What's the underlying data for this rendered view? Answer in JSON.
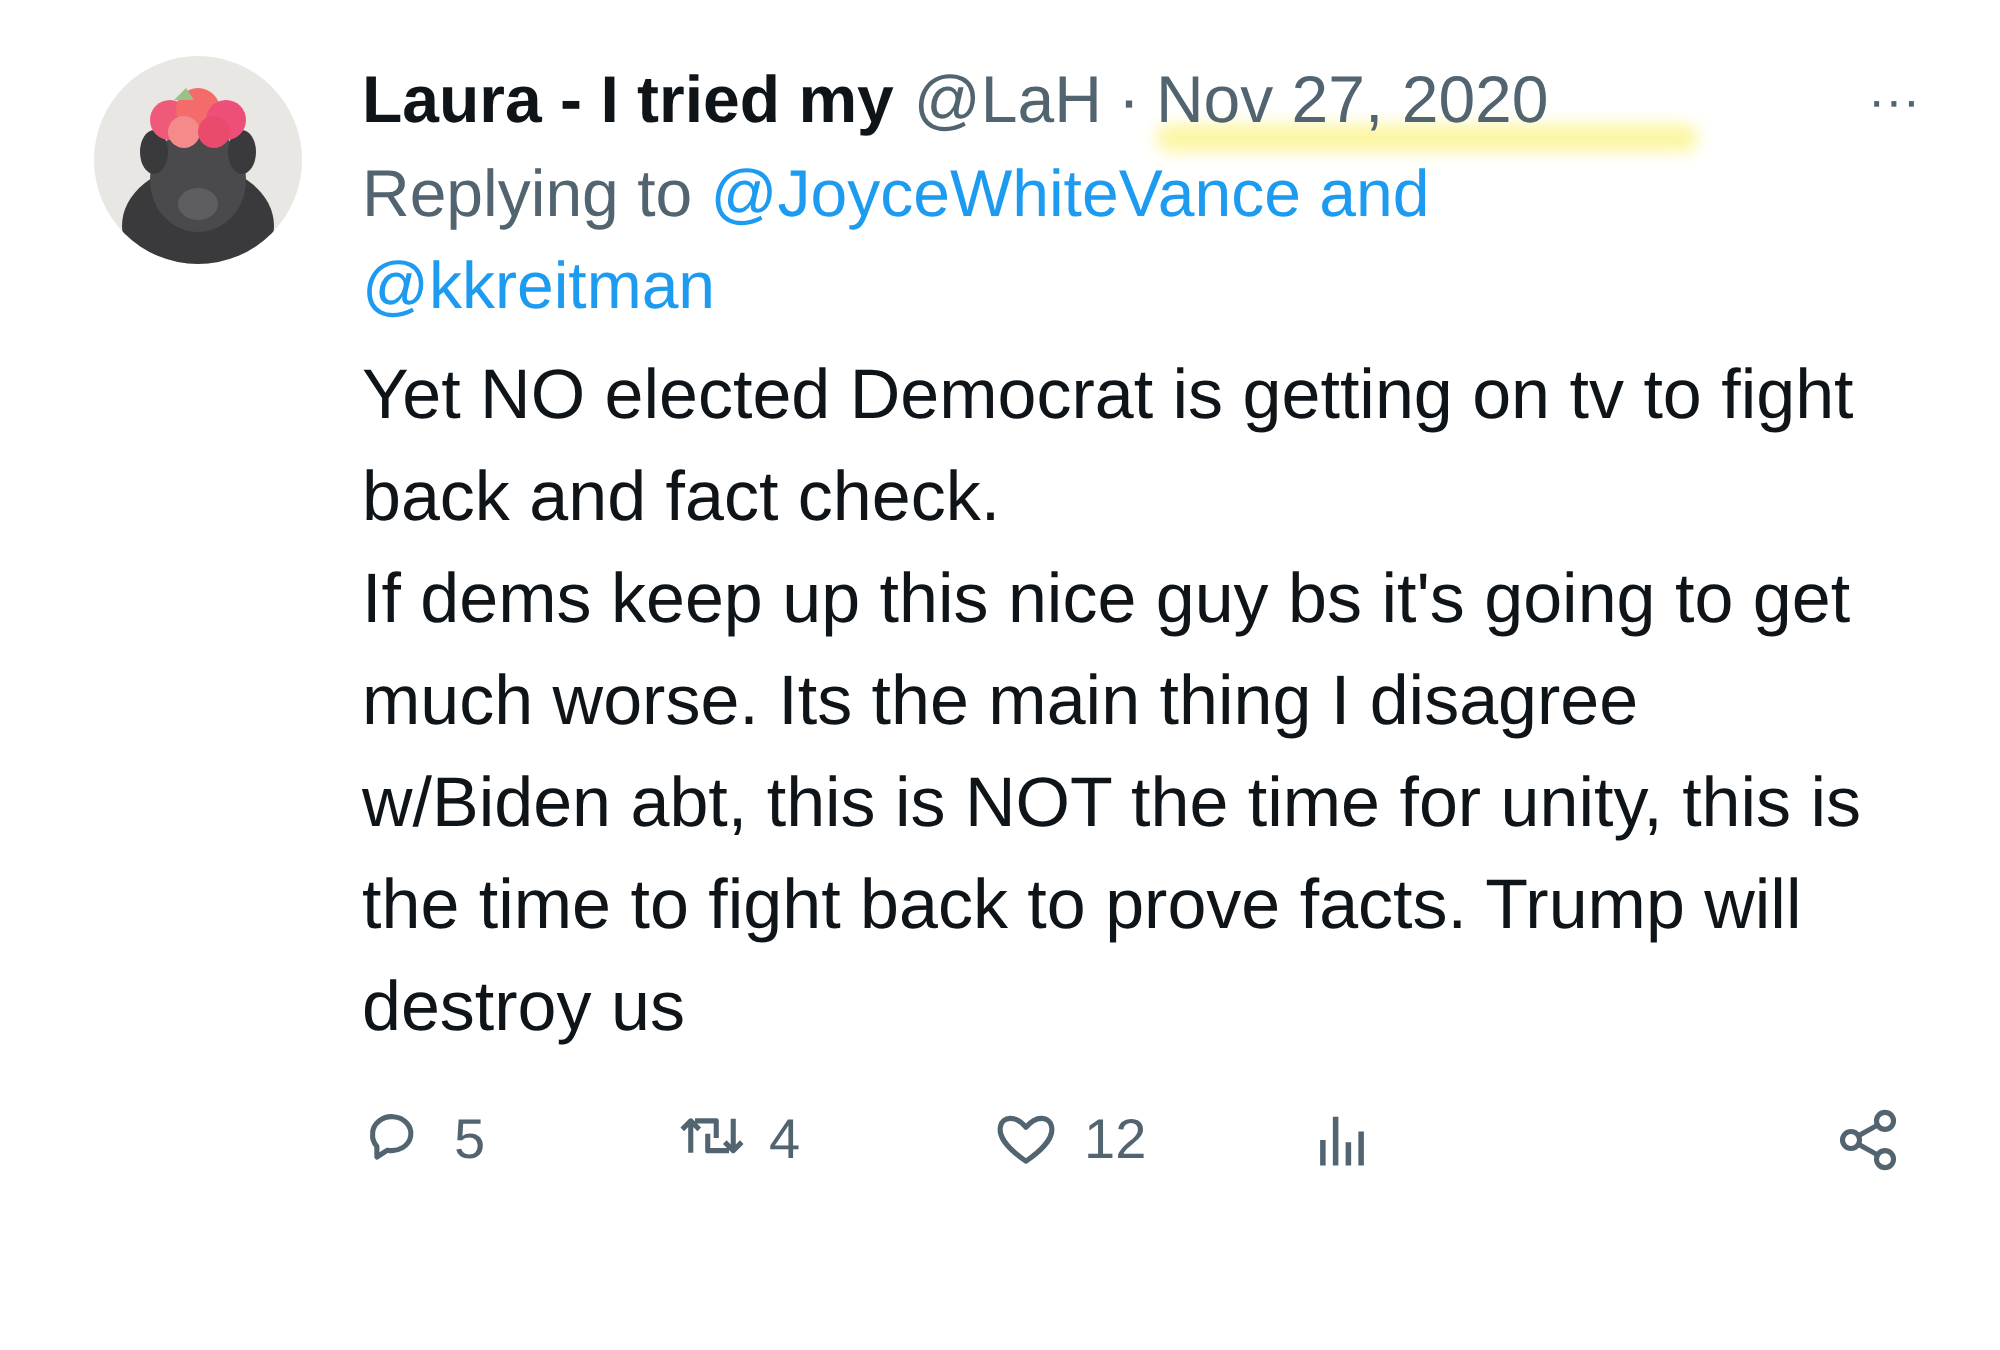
{
  "tweet": {
    "author_name": "Laura - I tried my",
    "handle": "@LaH",
    "separator": "·",
    "date": "Nov 27, 2020",
    "more": "···",
    "replying_prefix": "Replying to",
    "replying_to": [
      "@JoyceWhiteVance",
      "@kkreitman"
    ],
    "replying_joiner": "and",
    "paragraphs": [
      "Yet NO elected Democrat is getting on tv to fight back and fact check.",
      "If dems keep up this nice guy bs it's going to get much worse. Its the main thing I disagree w/Biden abt, this is NOT the time for unity, this is the time to fight back to prove facts. Trump will destroy us"
    ],
    "date_highlighted": true,
    "actions": [
      {
        "kind": "reply",
        "count": "5"
      },
      {
        "kind": "retweet",
        "count": "4"
      },
      {
        "kind": "like",
        "count": "12"
      },
      {
        "kind": "views"
      },
      {
        "kind": "share"
      }
    ]
  }
}
